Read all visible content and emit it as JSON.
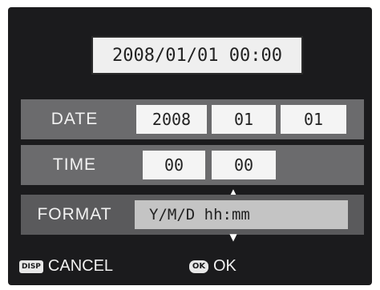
{
  "datetime_display": "2008/01/01 00:00",
  "date": {
    "label": "DATE",
    "year": "2008",
    "month": "01",
    "day": "01"
  },
  "time": {
    "label": "TIME",
    "hour": "00",
    "minute": "00"
  },
  "format": {
    "label": "FORMAT",
    "value": "Y/M/D hh:mm"
  },
  "footer": {
    "cancel_key": "DISP",
    "cancel_label": "CANCEL",
    "ok_key": "OK",
    "ok_label": "OK"
  },
  "icons": {
    "scroll_up": "triangle-up-icon",
    "scroll_down": "triangle-down-icon"
  }
}
